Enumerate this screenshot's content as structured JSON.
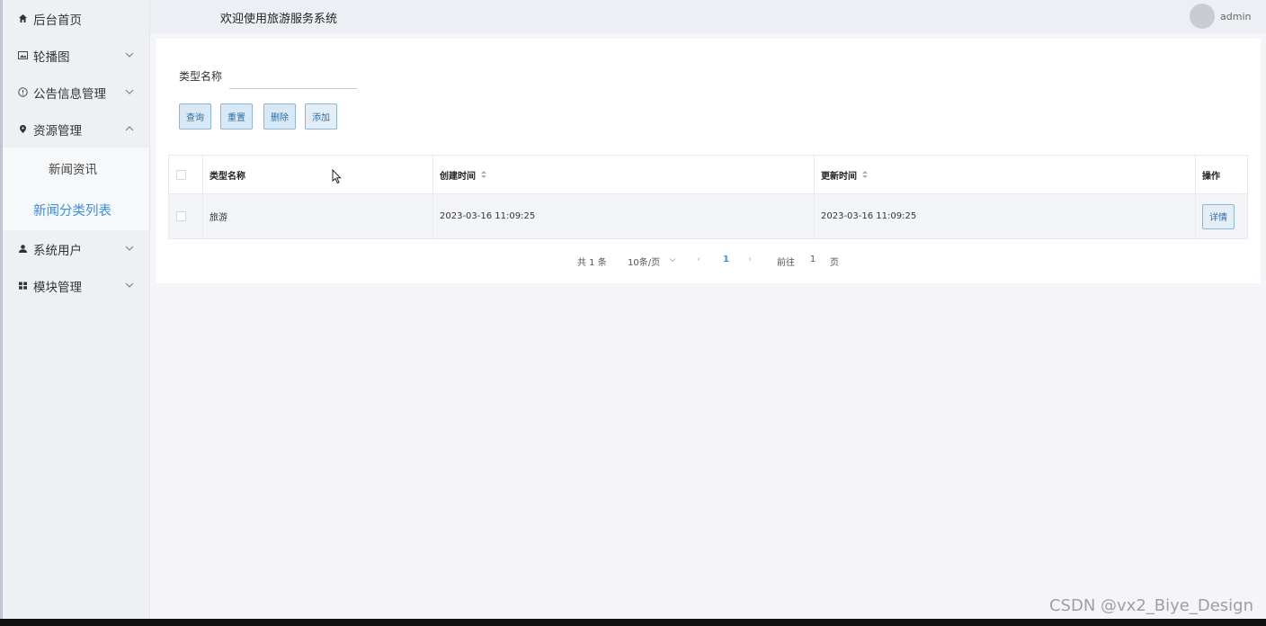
{
  "header": {
    "title": "欢迎使用旅游服务系统",
    "username": "admin"
  },
  "sidebar": {
    "items": [
      {
        "label": "后台首页",
        "icon": "home-icon"
      },
      {
        "label": "轮播图",
        "icon": "image-icon",
        "expanded": false
      },
      {
        "label": "公告信息管理",
        "icon": "info-circle-icon",
        "expanded": false
      },
      {
        "label": "资源管理",
        "icon": "location-icon",
        "expanded": true
      },
      {
        "label": "系统用户",
        "icon": "user-icon",
        "expanded": false
      },
      {
        "label": "模块管理",
        "icon": "grid-icon",
        "expanded": false
      }
    ],
    "submenu": [
      {
        "label": "新闻资讯",
        "active": false
      },
      {
        "label": "新闻分类列表",
        "active": true
      }
    ]
  },
  "search": {
    "label": "类型名称",
    "value": ""
  },
  "buttons": {
    "query": "查询",
    "reset": "重置",
    "delete": "删除",
    "add": "添加"
  },
  "table": {
    "columns": [
      "类型名称",
      "创建时间",
      "更新时间",
      "操作"
    ],
    "rows": [
      {
        "name": "旅游",
        "created": "2023-03-16 11:09:25",
        "updated": "2023-03-16 11:09:25",
        "action": "详情"
      }
    ]
  },
  "pagination": {
    "total": "共 1 条",
    "page_size": "10条/页",
    "prev": "‹",
    "current": "1",
    "next": "›",
    "goto_label": "前往",
    "goto_value": "1",
    "goto_unit": "页"
  },
  "watermark": "CSDN @vx2_Biye_Design",
  "colors": {
    "accent": "#3a8ee6",
    "sidebar_bg": "#eef1f4",
    "button_bg": "#d8e8f4"
  }
}
